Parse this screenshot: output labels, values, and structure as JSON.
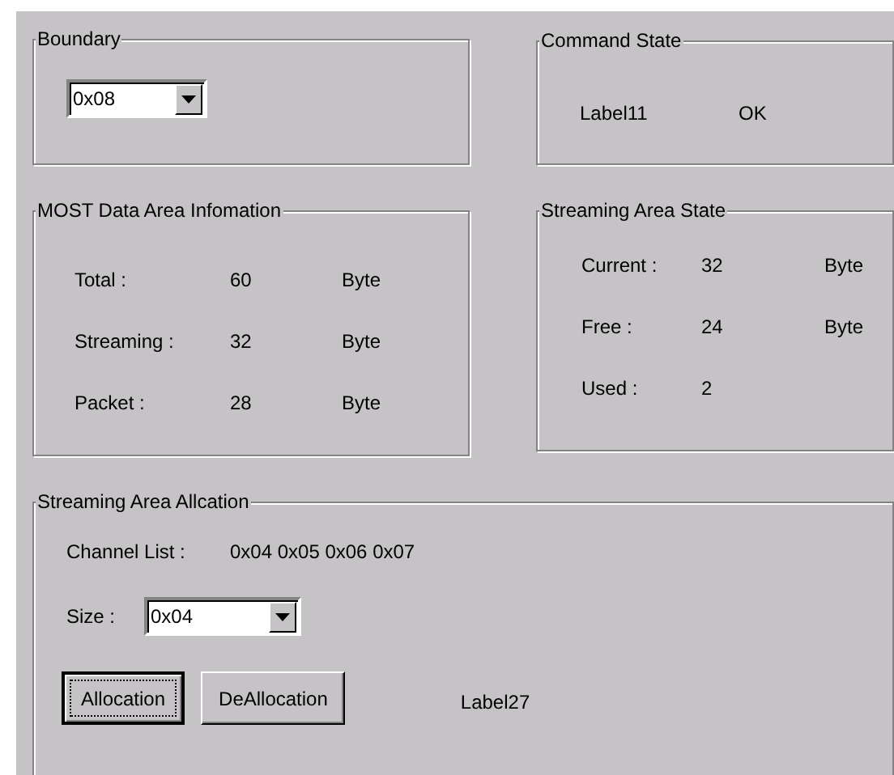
{
  "boundary": {
    "title": "Boundary",
    "combo": {
      "value": "0x08"
    }
  },
  "command_state": {
    "title": "Command State",
    "label": "Label11",
    "status": "OK"
  },
  "most_data_area": {
    "title": "MOST Data Area  Infomation",
    "rows": [
      {
        "label": "Total :",
        "value": "60",
        "unit": "Byte"
      },
      {
        "label": "Streaming :",
        "value": "32",
        "unit": "Byte"
      },
      {
        "label": "Packet :",
        "value": "28",
        "unit": "Byte"
      }
    ]
  },
  "streaming_state": {
    "title": "Streaming Area  State",
    "rows": [
      {
        "label": "Current :",
        "value": "32",
        "unit": "Byte"
      },
      {
        "label": "Free :",
        "value": "24",
        "unit": "Byte"
      },
      {
        "label": "Used :",
        "value": "2"
      }
    ]
  },
  "allocation": {
    "title": "Streaming Area Allcation",
    "channel_label": "Channel List :",
    "channels": "0x04 0x05 0x06 0x07",
    "size_label": "Size :",
    "size_combo": {
      "value": "0x04"
    },
    "buttons": [
      {
        "label": "Allocation",
        "focused": true
      },
      {
        "label": "DeAllocation",
        "focused": false
      }
    ],
    "status": "Label27"
  }
}
